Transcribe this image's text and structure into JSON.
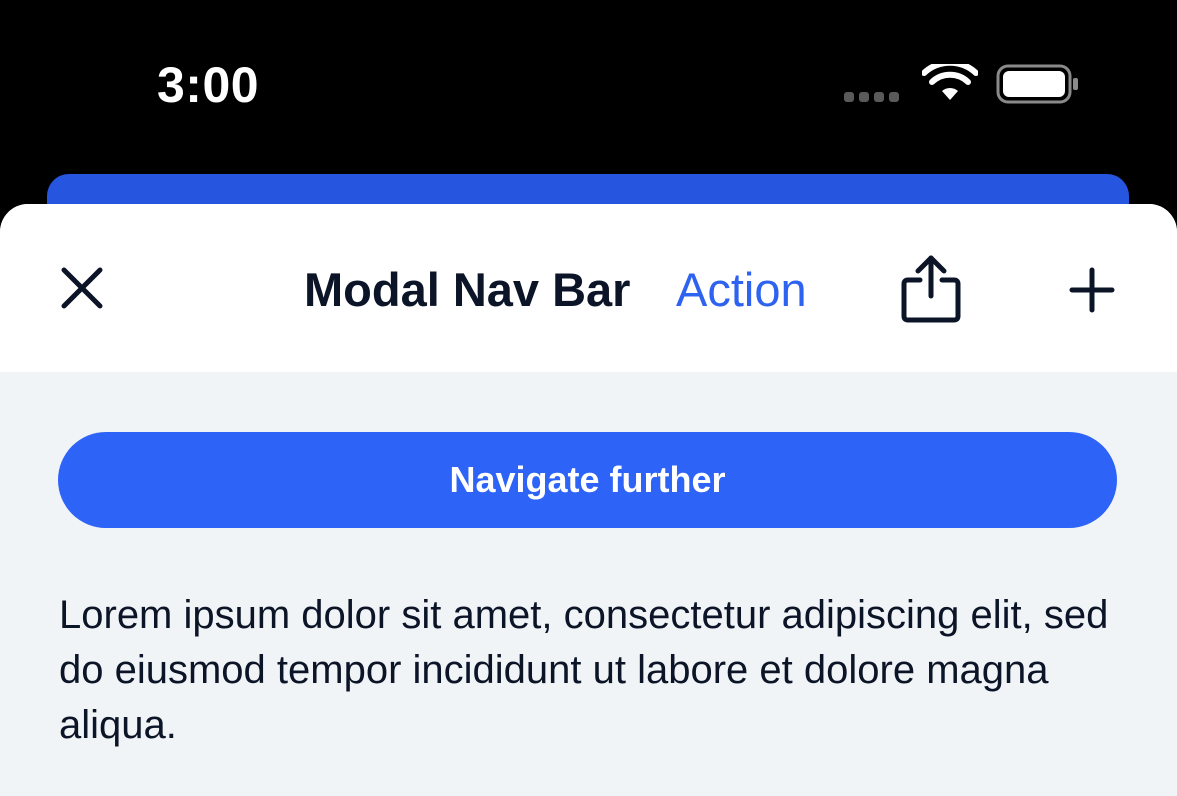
{
  "status_bar": {
    "time": "3:00",
    "icons": [
      "signal-dots-icon",
      "wifi-icon",
      "battery-icon"
    ]
  },
  "nav_bar": {
    "close_icon": "close-icon",
    "title": "Modal Nav Bar",
    "action_label": "Action",
    "share_icon": "share-icon",
    "add_icon": "plus-icon"
  },
  "content": {
    "primary_button_label": "Navigate further",
    "body_text": "Lorem ipsum dolor sit amet, consectetur adipiscing elit, sed do eiusmod tempor incididunt ut labore et dolore magna aliqua."
  },
  "colors": {
    "accent": "#2d63f7",
    "text": "#0c1527",
    "sheet_background": "#f1f4f7",
    "nav_background": "#ffffff",
    "status_background": "#000000"
  }
}
